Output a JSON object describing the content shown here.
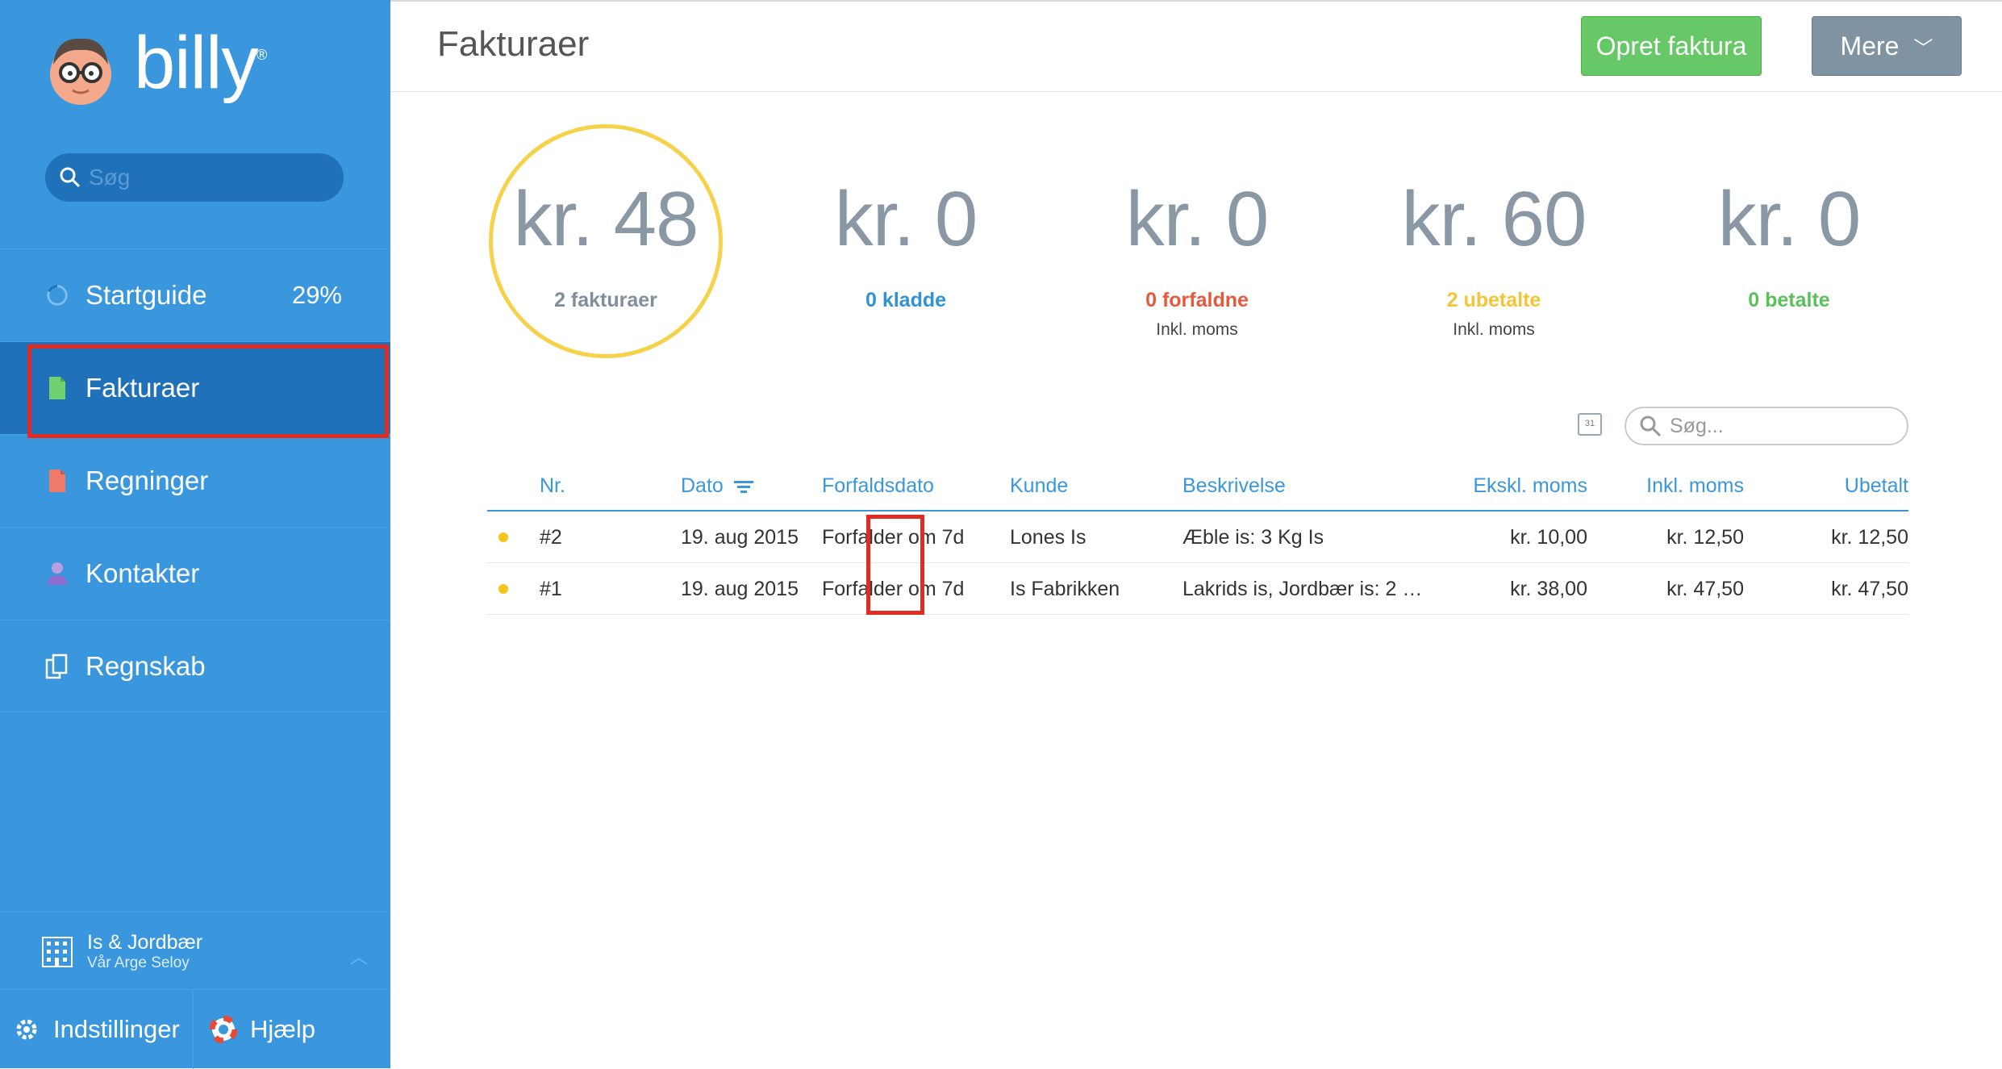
{
  "sidebar": {
    "logo_text": "billy",
    "logo_mark": "®",
    "search_placeholder": "Søg",
    "nav": [
      {
        "label": "Startguide",
        "icon": "progress-ring-icon",
        "pct": "29%"
      },
      {
        "label": "Fakturaer",
        "icon": "invoice-doc-icon",
        "active": true
      },
      {
        "label": "Regninger",
        "icon": "bill-doc-icon"
      },
      {
        "label": "Kontakter",
        "icon": "person-icon"
      },
      {
        "label": "Regnskab",
        "icon": "ledger-icon"
      }
    ],
    "company": {
      "name": "Is & Jordbær",
      "sub": "Vår Arge Seloy",
      "icon": "building-icon"
    },
    "settings_label": "Indstillinger",
    "help_label": "Hjælp"
  },
  "header": {
    "title": "Fakturaer",
    "create_label": "Opret faktura",
    "more_label": "Mere"
  },
  "stats": [
    {
      "amount": "kr. 48",
      "label": "2 fakturaer",
      "color": "#7f8f9c",
      "sub": ""
    },
    {
      "amount": "kr. 0",
      "label": "0 kladde",
      "color": "#2f93d6",
      "sub": ""
    },
    {
      "amount": "kr. 0",
      "label": "0 forfaldne",
      "color": "#e65a3c",
      "sub": "Inkl. moms"
    },
    {
      "amount": "kr. 60",
      "label": "2 ubetalte",
      "color": "#f4c534",
      "sub": "Inkl. moms"
    },
    {
      "amount": "kr. 0",
      "label": "0 betalte",
      "color": "#5bbf5b",
      "sub": ""
    }
  ],
  "filter": {
    "search_placeholder": "Søg...",
    "calendar_day": "31"
  },
  "table": {
    "columns": [
      "Nr.",
      "Dato",
      "Forfaldsdato",
      "Kunde",
      "Beskrivelse",
      "Ekskl. moms",
      "Inkl. moms",
      "Ubetalt"
    ],
    "rows": [
      {
        "status": "unpaid",
        "nr": "#2",
        "dato": "19. aug 2015",
        "forfald": "Forfalder om 7d",
        "kunde": "Lones Is",
        "beskrivelse": "Æble is: 3 Kg Is",
        "ekskl": "kr. 10,00",
        "inkl": "kr. 12,50",
        "ubetalt": "kr. 12,50"
      },
      {
        "status": "unpaid",
        "nr": "#1",
        "dato": "19. aug 2015",
        "forfald": "Forfalder om 7d",
        "kunde": "Is Fabrikken",
        "beskrivelse": "Lakrids is, Jordbær is: 2 …",
        "ekskl": "kr. 38,00",
        "inkl": "kr. 47,50",
        "ubetalt": "kr. 47,50"
      }
    ]
  },
  "colors": {
    "sidebar": "#3a97dd",
    "sidebar_active": "#1f72b9",
    "accent": "#3a97dd",
    "highlight": "#e02c23",
    "status_unpaid": "#f5c518"
  }
}
